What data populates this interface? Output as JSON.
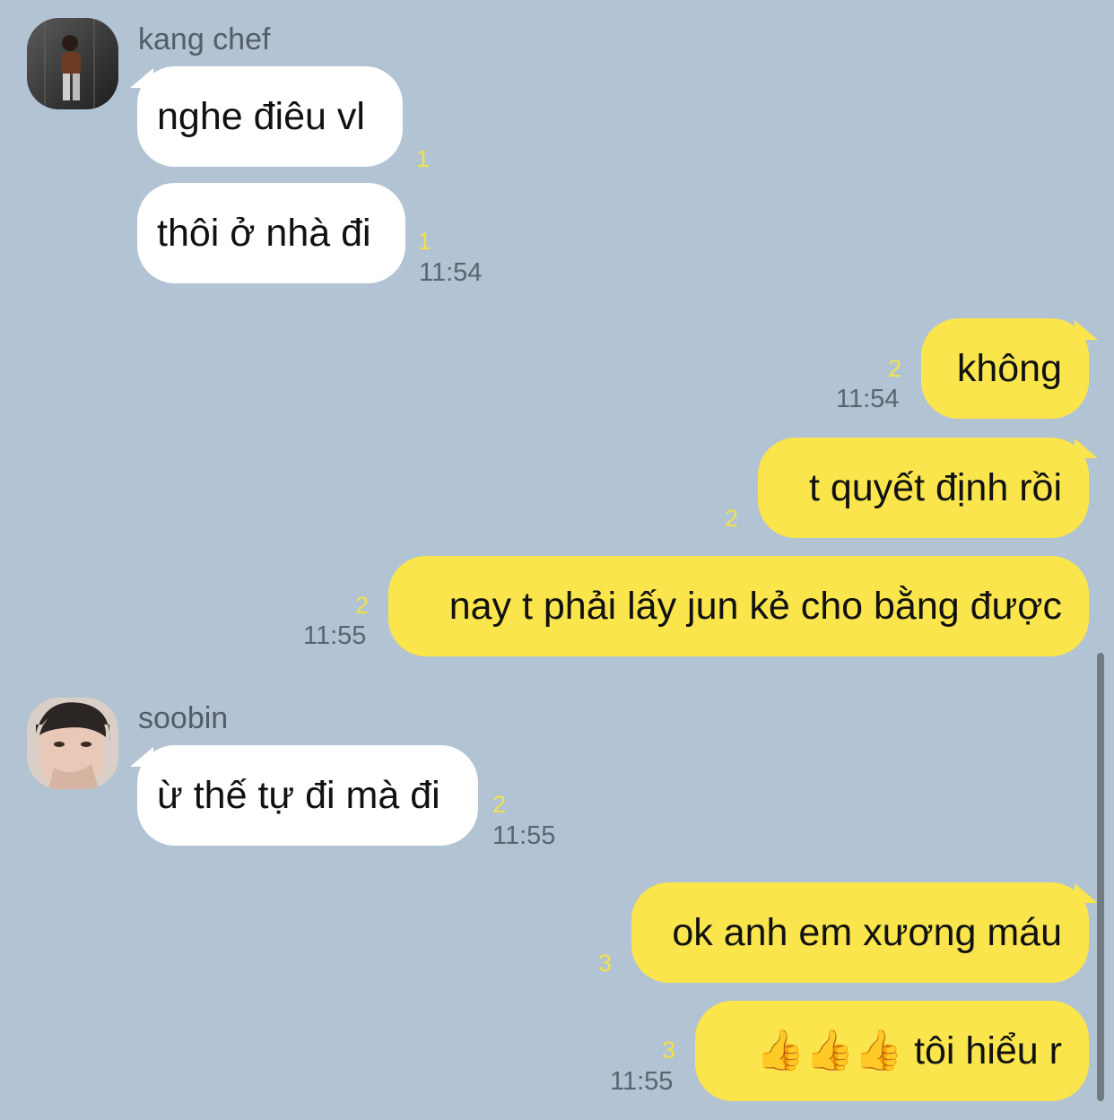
{
  "chat": {
    "group1": {
      "sender": "kang chef",
      "avatar_icon": "person-leaning-on-wall-avatar",
      "messages": [
        {
          "text": "nghe điêu vl",
          "count": "1"
        },
        {
          "text": "thôi ở nhà đi",
          "count": "1",
          "time": "11:54"
        }
      ]
    },
    "group2": {
      "messages": [
        {
          "text": "không",
          "count": "2",
          "time": "11:54"
        },
        {
          "text": "t quyết định rồi",
          "count": "2"
        },
        {
          "text": "nay t phải lấy jun kẻ cho bằng được",
          "count": "2",
          "time": "11:55"
        }
      ]
    },
    "group3": {
      "sender": "soobin",
      "avatar_icon": "person-selfie-avatar",
      "messages": [
        {
          "text": "ừ thế tự đi mà đi",
          "count": "2",
          "time": "11:55"
        }
      ]
    },
    "group4": {
      "messages": [
        {
          "text": "ok anh em xương máu",
          "count": "3"
        },
        {
          "text": "tôi hiểu r",
          "emoji": "👍👍👍",
          "count": "3",
          "time": "11:55"
        }
      ]
    }
  },
  "colors": {
    "background": "#b2c3d3",
    "incoming_bubble": "#ffffff",
    "outgoing_bubble": "#fae54d",
    "unread_count": "#f1e24a",
    "timestamp": "#5a6570"
  }
}
